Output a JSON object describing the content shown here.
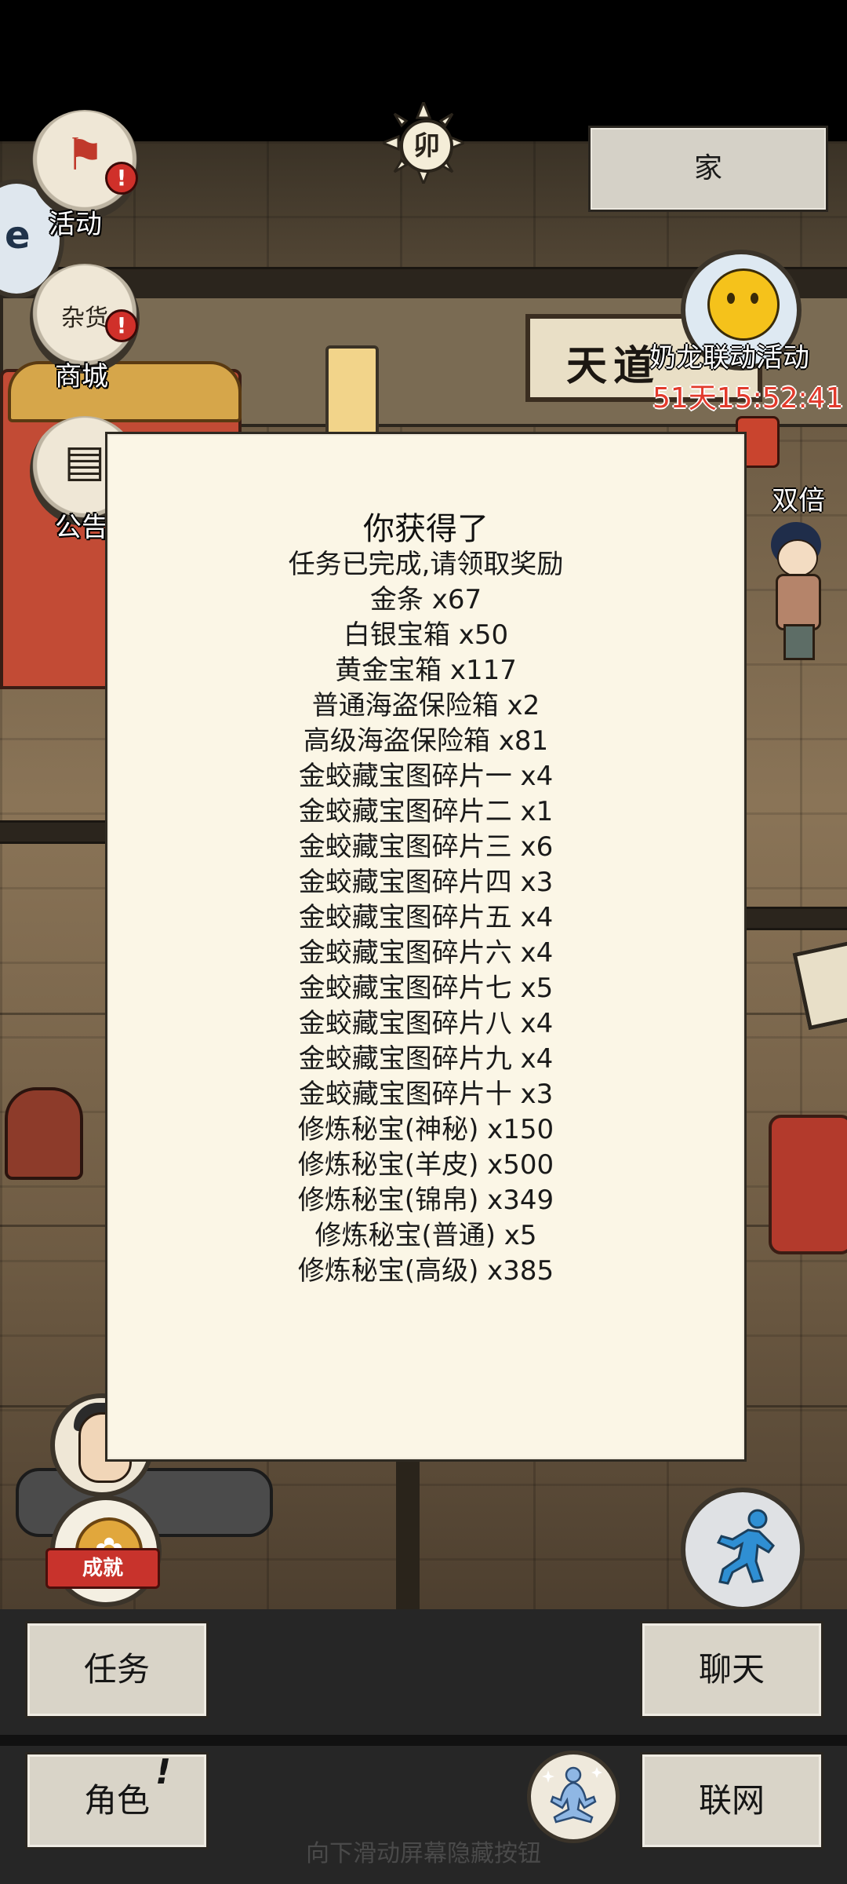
{
  "top": {
    "sun_glyph": "卯",
    "home_label": "家"
  },
  "left_menu": {
    "activity_label": "活动",
    "shop_label": "商城",
    "notice_label": "公告",
    "shop_sign": "杂货",
    "achievement_label": "成就"
  },
  "event": {
    "title": "奶龙联动活动",
    "timer": "51天15:52:41",
    "double_label": "双倍"
  },
  "scene": {
    "signboard": "天道"
  },
  "modal": {
    "title": "你获得了",
    "items": [
      "任务已完成,请领取奖励",
      "金条 x67",
      "白银宝箱 x50",
      "黄金宝箱 x117",
      "普通海盗保险箱 x2",
      "高级海盗保险箱 x81",
      "金蛟藏宝图碎片一 x4",
      "金蛟藏宝图碎片二 x1",
      "金蛟藏宝图碎片三 x6",
      "金蛟藏宝图碎片四 x3",
      "金蛟藏宝图碎片五 x4",
      "金蛟藏宝图碎片六 x4",
      "金蛟藏宝图碎片七 x5",
      "金蛟藏宝图碎片八 x4",
      "金蛟藏宝图碎片九 x4",
      "金蛟藏宝图碎片十 x3",
      "修炼秘宝(神秘) x150",
      "修炼秘宝(羊皮) x500",
      "修炼秘宝(锦帛) x349",
      "修炼秘宝(普通) x5",
      "修炼秘宝(高级) x385"
    ]
  },
  "bottom": {
    "task_label": "任务",
    "chat_label": "聊天",
    "role_label": "角色",
    "role_mark": "!",
    "network_label": "联网",
    "hint": "向下滑动屏幕隐藏按钮"
  },
  "colors": {
    "modal_bg": "#fbf6e6",
    "timer_red": "#e23a2c",
    "button_bg": "#d9d4c8",
    "bottom_bg": "#262626"
  },
  "icons": {
    "activity": "flag-scroll-icon",
    "shop": "shop-stall-icon",
    "notice": "notice-board-icon",
    "sun": "sun-clock-icon",
    "run": "running-person-icon",
    "meditate": "meditation-icon",
    "achievement": "medal-icon"
  }
}
